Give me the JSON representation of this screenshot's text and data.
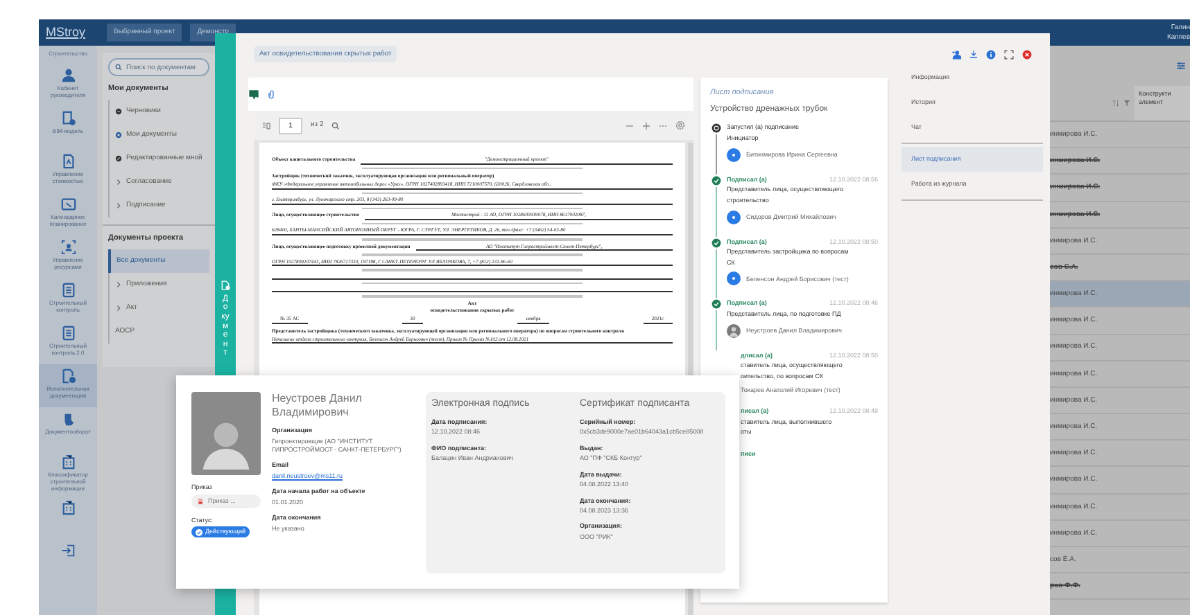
{
  "topbar": {
    "logo": "MStroy",
    "tabs": [
      {
        "label": "Выбранный проект",
        "selected": false
      },
      {
        "label": "Демонстр",
        "selected": false
      }
    ],
    "user": [
      "Галин",
      "Каппев"
    ]
  },
  "sidebar": {
    "section": "Строительство",
    "items": [
      {
        "kind": "person",
        "label": "Кабинет руководителя",
        "selected": false
      },
      {
        "kind": "model",
        "label": "BIM-модель",
        "selected": false
      },
      {
        "kind": "doc",
        "label": "Управление стоимостью",
        "selected": false
      },
      {
        "kind": "calendar",
        "label": "Календарное планирование",
        "selected": false
      },
      {
        "kind": "people",
        "label": "Управление ресурсами",
        "selected": false
      },
      {
        "kind": "list",
        "label": "Строительный контроль",
        "selected": false
      },
      {
        "kind": "list",
        "label": "Строительный контроль 2.0",
        "selected": false
      },
      {
        "kind": "doccheck",
        "label": "Исполнительная документация",
        "selected": true
      },
      {
        "kind": "hand",
        "label": "Документооборот",
        "selected": false
      },
      {
        "kind": "building",
        "label": "Классификатор строительной информации",
        "selected": false
      },
      {
        "kind": "building",
        "selected": false
      },
      {
        "kind": "exit",
        "selected": false
      }
    ]
  },
  "docs": {
    "search": {
      "placeholder": "Поиск по документам"
    },
    "my_title": "Мои документы",
    "my_items": [
      {
        "kind": "draft",
        "label": "Черновики",
        "selected": false
      },
      {
        "kind": "mine",
        "label": "Мои документы",
        "selected": false
      },
      {
        "kind": "edited",
        "label": "Редактированные мной",
        "selected": false
      },
      {
        "kind": "folder",
        "label": "Согласование",
        "selected": false
      },
      {
        "kind": "folder",
        "label": "Подписание",
        "selected": false
      }
    ],
    "project_title": "Документы проекта",
    "project_items": [
      {
        "kind": "plain",
        "label": "Все документы",
        "selected": true
      },
      {
        "kind": "folder",
        "label": "Приложения",
        "selected": false
      },
      {
        "kind": "folder",
        "label": "Акт",
        "selected": false
      },
      {
        "kind": "plain",
        "label": "АОСР",
        "selected": false
      }
    ]
  },
  "table": {
    "column": "Конструкти элемент",
    "rows": [
      {
        "text": "инмирова И.С.",
        "struck": false,
        "selected": false
      },
      {
        "text": "инмирова И.С.",
        "struck": true,
        "selected": false
      },
      {
        "text": "инмирова И.С.",
        "struck": true,
        "selected": false
      },
      {
        "text": "инмирова И.С.",
        "struck": true,
        "selected": false
      },
      {
        "text": "инмирова И.С.",
        "struck": false,
        "selected": false
      },
      {
        "text": "сов С.А.",
        "struck": true,
        "selected": false
      },
      {
        "text": "инмирова И.С.",
        "struck": false,
        "selected": true
      },
      {
        "text": "инмирова И.С.",
        "struck": false,
        "selected": false
      },
      {
        "text": "инмирова И.С.",
        "struck": false,
        "selected": false
      },
      {
        "text": "инмирова И.С.",
        "struck": false,
        "selected": false
      },
      {
        "text": "инмирова И.С.",
        "struck": false,
        "selected": false
      },
      {
        "text": "инмирова И.С.",
        "struck": false,
        "selected": false
      },
      {
        "text": "инмирова И.С.",
        "struck": false,
        "selected": false
      },
      {
        "text": "инмирова И.С.",
        "struck": false,
        "selected": false
      },
      {
        "text": "инмирова И.С.",
        "struck": false,
        "selected": false
      },
      {
        "text": "инмирова И.С.",
        "struck": false,
        "selected": false
      },
      {
        "text": "сов Е.А.",
        "struck": false,
        "selected": false
      },
      {
        "text": "ров Ф.Ф.",
        "struck": true,
        "selected": false
      }
    ]
  },
  "modal": {
    "side_tab": "Документ",
    "doc_chip": "Акт освидетельствования скрытых работ",
    "viewer": {
      "page": "1",
      "page_total": "из 2",
      "lines": [
        {
          "kind": "field",
          "label": "Объект капитального строительства",
          "value": "\"Демонстрационный проект\""
        },
        {
          "kind": "caption"
        },
        {
          "kind": "heading",
          "text": "Застройщик (технический заказчик, эксплуатирующая организация или региональный оператор)"
        },
        {
          "kind": "value",
          "text": "ФКУ «Федеральное управление автомобильных дорог «Урал», ОГРН 1027402893418, ИНН 7210007570, 620026, Свердловская обл.,"
        },
        {
          "kind": "caption"
        },
        {
          "kind": "value",
          "text": "г. Екатеринбург, ул. Луначарского стр. 203, 8 (343) 263-09-80"
        },
        {
          "kind": "caption"
        },
        {
          "kind": "field",
          "label": "Лицо, осуществляющее строительство",
          "value": "Мостострой - 11 АО, ОГРН 1028600939078, ИНН 8617002087,"
        },
        {
          "kind": "caption"
        },
        {
          "kind": "value",
          "text": "628400, ХАНТЫ-МАНСИЙСКИЙ АВТОНОМНЫЙ ОКРУГ - ЮГРА, Г. СУРГУТ, УЛ. ЭНЕРГЕТИКОВ, Д. 26, тел./факс: +7 (3462) 54-03-80"
        },
        {
          "kind": "caption"
        },
        {
          "kind": "field",
          "label": "Лицо, осуществляющее подготовку проектной документации",
          "value": "АО \"Институт Гипростроймост-Санкт-Петербург\","
        },
        {
          "kind": "caption"
        },
        {
          "kind": "value",
          "text": "ОГРН 1027809207443, ИНН 7826717330, 197198, Г САНКТ-ПЕТЕРБУРГ УЛ ЯБЛОЧКОВА, 7, +7 (812) 233-96-60"
        },
        {
          "kind": "caption"
        },
        {
          "kind": "rule"
        },
        {
          "kind": "caption"
        },
        {
          "kind": "rule"
        },
        {
          "kind": "caption"
        },
        {
          "kind": "title",
          "text": "Акт"
        },
        {
          "kind": "title",
          "text": "освидетельствования скрытых работ"
        },
        {
          "kind": "dateline",
          "parts": [
            "№ 35 АС",
            "30",
            "ноября",
            "2021г."
          ]
        },
        {
          "kind": "heading",
          "text": "Представитель застройщика (технического заказчика, эксплуатирующей организации или регионального оператора) по вопросам строительного контроля"
        },
        {
          "kind": "value",
          "text": "Начальник отдела строительного контроля, Беленсон Андрей Борисович (тест), Приказ № Приказ №102 от 12.08.2021"
        }
      ]
    },
    "signing": {
      "title": "Лист подписания",
      "subject": "Устройство дренажных трубок",
      "steps": [
        {
          "kind": "started",
          "status": "Запустил (а) подписание",
          "role": [
            "Инициатор"
          ],
          "person": "Битинмирова Ирина Сергеевна",
          "has_photo": false
        },
        {
          "kind": "signed",
          "status": "Подписал (а)",
          "date": "12.10.2022 08:56",
          "role": [
            "Представитель лица, осуществляющего",
            "строительство"
          ],
          "person": "Сидоров Дмитрий Михайлович",
          "has_photo": false
        },
        {
          "kind": "signed",
          "status": "Подписал (а)",
          "date": "12.10.2022 08:50",
          "role": [
            "Представитель застройщика по вопросам",
            "СК"
          ],
          "person": "Беленсон Андрей Борисович (тест)",
          "has_photo": false
        },
        {
          "kind": "signed",
          "status": "Подписал (а)",
          "date": "12.10.2022 08:46",
          "role": [
            "Представитель лица, по подготовке ПД"
          ],
          "person": "Неустроев Данил Владимирович",
          "has_photo": true
        },
        {
          "kind": "covered",
          "status": "дписал (а)",
          "date": "12.10.2022 08:50",
          "role": [
            "ставитель лица, осуществляющего",
            "оительство, по вопросам СК"
          ],
          "person": "Токарев Анатолий Игоревич (тест)"
        },
        {
          "kind": "covered",
          "status": "писал (а)",
          "date": "12.10.2022 08:49",
          "role": [
            "ставитель лица, выполнившего",
            "оты"
          ]
        }
      ],
      "more_link": "писи"
    },
    "nav": [
      {
        "label": "Информация",
        "selected": false
      },
      {
        "label": "История",
        "selected": false
      },
      {
        "label": "Чат",
        "selected": false,
        "divider_after": true
      },
      {
        "label": "Лист подписания",
        "selected": true
      },
      {
        "label": "Работа из журнала",
        "selected": false,
        "divider_after": true
      }
    ]
  },
  "popup": {
    "name": "Неустроев Данил Владимирович",
    "order_label": "Приказ",
    "order_file": "Приказ ...",
    "status_label": "Статус:",
    "status": "Действующий",
    "fields": [
      {
        "kind": "text",
        "label": "Организация",
        "value": "Гипроектировщик (АО \"ИНСТИТУТ ГИПРОСТРОЙМОСТ - САНКТ-ПЕТЕРБУРГ\")"
      },
      {
        "kind": "link",
        "label": "Email",
        "value": "danil.neustroev@ms11.ru"
      },
      {
        "kind": "text",
        "label": "Дата начала работ на объекте",
        "value": "01.01.2020"
      },
      {
        "kind": "text",
        "label": "Дата окончания",
        "value": "Не указано"
      }
    ],
    "signature": {
      "title": "Электронная подпись",
      "fields": [
        {
          "label": "Дата подписания:",
          "value": "12.10.2022 08:46"
        },
        {
          "label": "ФИО подписанта:",
          "value": "Балацин Иван Андрианович"
        }
      ]
    },
    "certificate": {
      "title": "Сертификат подписанта",
      "fields": [
        {
          "label": "Серийный номер:",
          "value": "0x5cb3de9000e7ae01b64043a1cb5ce85008"
        },
        {
          "label": "Выдан:",
          "value": "АО \"ПФ \"СКБ Контур\""
        },
        {
          "label": "Дата выдачи:",
          "value": "04.08.2022 13:40"
        },
        {
          "label": "Дата окончания:",
          "value": "04.08.2023 13:36"
        },
        {
          "label": "Организация:",
          "value": "ООО \"РИК\""
        }
      ]
    }
  }
}
